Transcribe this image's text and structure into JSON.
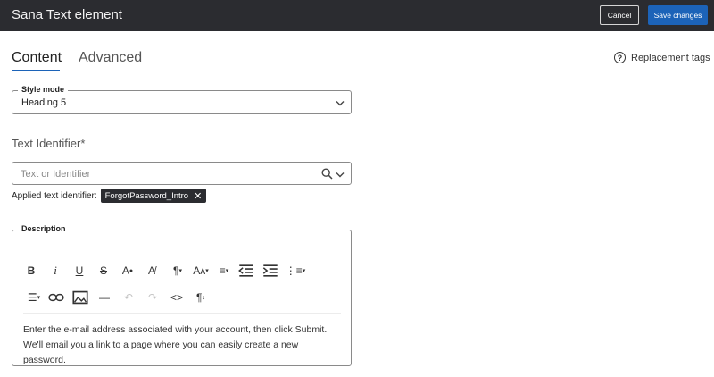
{
  "window": {
    "title": "Sana Text element"
  },
  "header": {
    "cancel_label": "Cancel",
    "save_label": "Save changes"
  },
  "tabs": [
    {
      "label": "Content",
      "active": true
    },
    {
      "label": "Advanced",
      "active": false
    }
  ],
  "replacement_tags": {
    "label": "Replacement tags",
    "icon": "question-circle-icon"
  },
  "style_mode": {
    "label": "Style mode",
    "value": "Heading 5"
  },
  "text_identifier": {
    "label": "Text Identifier*",
    "placeholder": "Text or Identifier",
    "value": "",
    "applied_label": "Applied text identifier:",
    "applied_tag": "ForgotPassword_Intro"
  },
  "description": {
    "label": "Description",
    "toolbar_row1": [
      "bold-icon",
      "italic-icon",
      "underline-icon",
      "strikethrough-icon",
      "text-color-icon",
      "clear-formatting-icon",
      "paragraph-format-icon",
      "font-size-icon",
      "align-icon",
      "outdent-icon",
      "indent-icon",
      "ordered-list-icon"
    ],
    "toolbar_row2": [
      "unordered-list-icon",
      "link-icon",
      "image-icon",
      "horizontal-line-icon",
      "undo-icon",
      "redo-icon",
      "code-view-icon",
      "paragraph-style-icon"
    ],
    "text_line1": "Enter the e-mail address associated with your account, then click Submit.",
    "text_line2": "We'll email you a link to a page where you can easily create a new password."
  },
  "colors": {
    "titlebar": "#2b2c30",
    "primary": "#1c63b8",
    "chip_bg": "#2b2c30"
  }
}
